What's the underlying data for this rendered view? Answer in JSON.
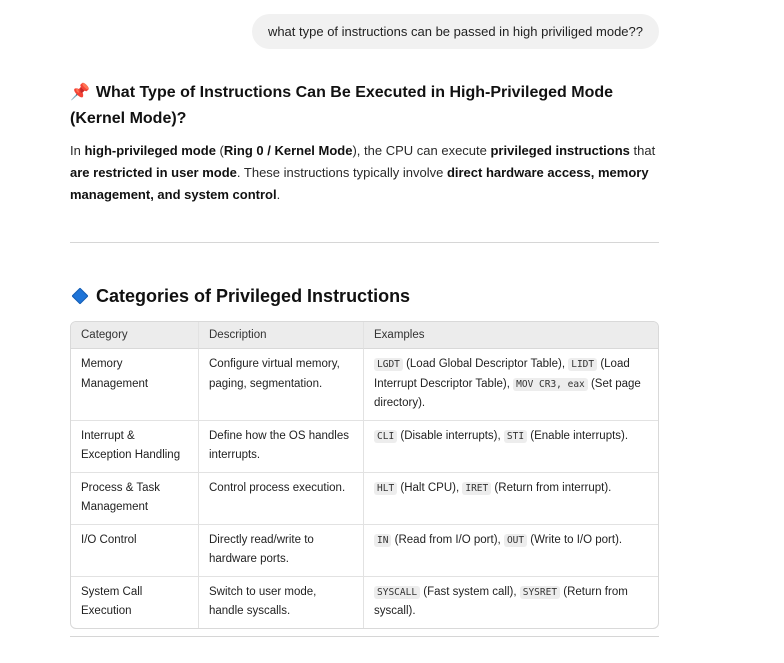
{
  "user_message": "what type of instructions can be passed in high priviliged mode??",
  "answer": {
    "title_icon": "pushpin-icon",
    "title": "What Type of Instructions Can Be Executed in High-Privileged Mode (Kernel Mode)?",
    "intro": {
      "t1": "In ",
      "b1": "high-privileged mode",
      "t2": " (",
      "b2": "Ring 0 / Kernel Mode",
      "t3": "), the CPU can execute ",
      "b3": "privileged instructions",
      "t4": " that ",
      "b4": "are restricted in user mode",
      "t5": ". These instructions typically involve ",
      "b5": "direct hardware access, memory management, and system control",
      "t6": "."
    },
    "section_icon": "blue-diamond-icon",
    "section_title": "Categories of Privileged Instructions",
    "table": {
      "headers": [
        "Category",
        "Description",
        "Examples"
      ],
      "rows": [
        {
          "category": "Memory Management",
          "description": "Configure virtual memory, paging, segmentation.",
          "examples": [
            {
              "code": "LGDT",
              "text": " (Load Global Descriptor Table), "
            },
            {
              "code": "LIDT",
              "text": " (Load Interrupt Descriptor Table), "
            },
            {
              "code": "MOV CR3, eax",
              "text": " (Set page directory)."
            }
          ]
        },
        {
          "category": "Interrupt & Exception Handling",
          "description": "Define how the OS handles interrupts.",
          "examples": [
            {
              "code": "CLI",
              "text": " (Disable interrupts), "
            },
            {
              "code": "STI",
              "text": " (Enable interrupts)."
            }
          ]
        },
        {
          "category": "Process & Task Management",
          "description": "Control process execution.",
          "examples": [
            {
              "code": "HLT",
              "text": " (Halt CPU), "
            },
            {
              "code": "IRET",
              "text": " (Return from interrupt)."
            }
          ]
        },
        {
          "category": "I/O Control",
          "description": "Directly read/write to hardware ports.",
          "examples": [
            {
              "code": "IN",
              "text": " (Read from I/O port), "
            },
            {
              "code": "OUT",
              "text": " (Write to I/O port)."
            }
          ]
        },
        {
          "category": "System Call Execution",
          "description": "Switch to user mode, handle syscalls.",
          "examples": [
            {
              "code": "SYSCALL",
              "text": " (Fast system call), "
            },
            {
              "code": "SYSRET",
              "text": " (Return from syscall)."
            }
          ]
        }
      ]
    }
  }
}
